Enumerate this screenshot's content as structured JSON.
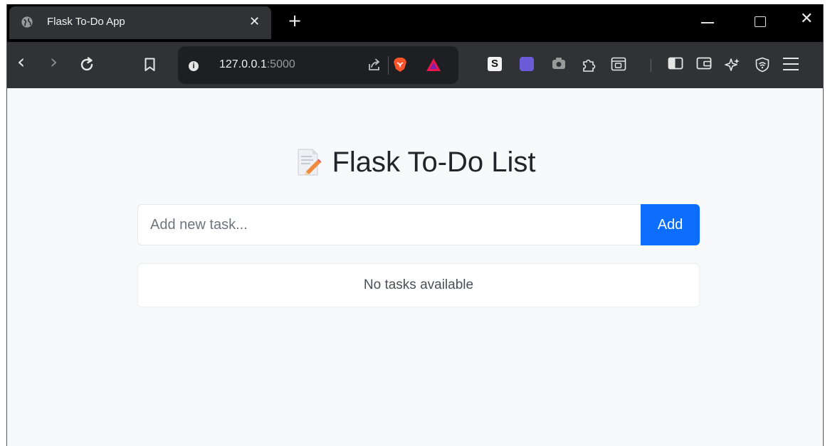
{
  "browser": {
    "tab": {
      "title": "Flask To-Do App"
    },
    "url": {
      "host": "127.0.0.1",
      "port": ":5000"
    },
    "icons": {
      "tab_favicon": "globe-icon",
      "extensions": [
        "s-extension-icon",
        "purple-extension-icon",
        "camera-extension-icon",
        "puzzle-icon",
        "tab-search-icon",
        "sidebar-icon",
        "wallet-icon",
        "leo-ai-icon",
        "vpn-icon",
        "menu-icon"
      ]
    }
  },
  "page": {
    "heading": "Flask To-Do List",
    "heading_icon": "memo-icon",
    "form": {
      "placeholder": "Add new task...",
      "value": "",
      "add_label": "Add"
    },
    "empty_message": "No tasks available"
  },
  "colors": {
    "accent": "#0d6efd",
    "page_bg": "#f8f9fb",
    "toolbar": "#313235",
    "tabstrip": "#000000"
  }
}
